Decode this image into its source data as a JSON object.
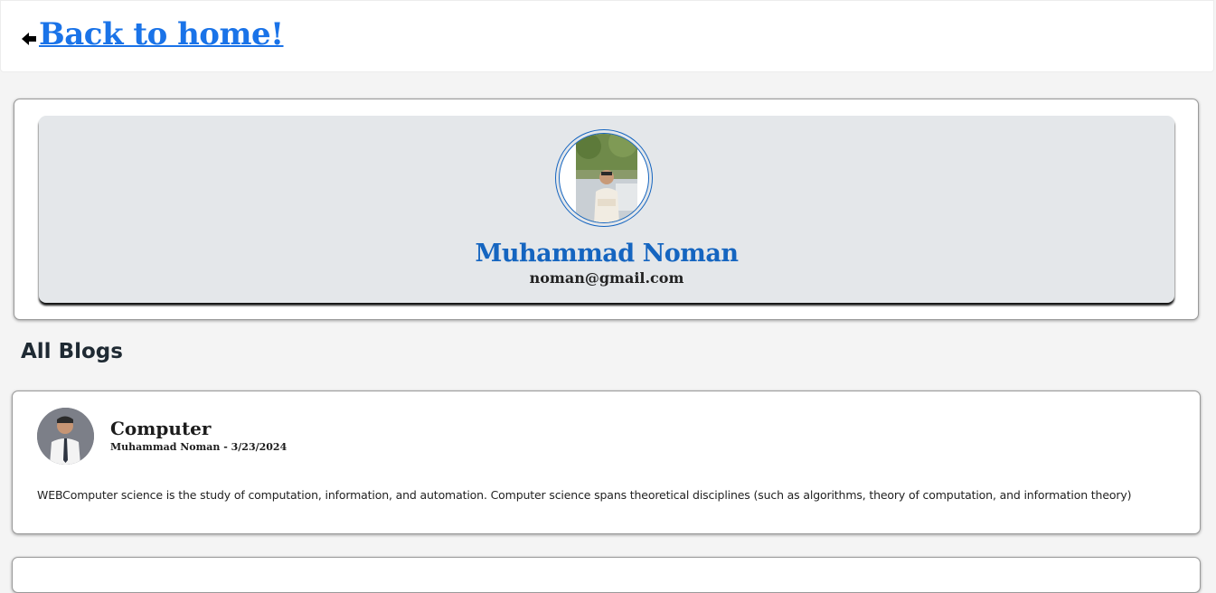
{
  "header": {
    "back_label": "Back to home!",
    "back_icon": "arrow-left-icon",
    "link_color": "#1a73e8"
  },
  "profile": {
    "name": "Muhammad Noman",
    "email": "noman@gmail.com",
    "name_color": "#1565c0",
    "avatar_icon": "profile-photo"
  },
  "blogs_section": {
    "title": "All Blogs",
    "items": [
      {
        "title": "Computer",
        "author": "Muhammad Noman",
        "separator": " - ",
        "date": "3/23/2024",
        "body": "WEBComputer science is the study of computation, information, and automation. Computer science spans theoretical disciplines (such as algorithms, theory of computation, and information theory)"
      }
    ]
  }
}
